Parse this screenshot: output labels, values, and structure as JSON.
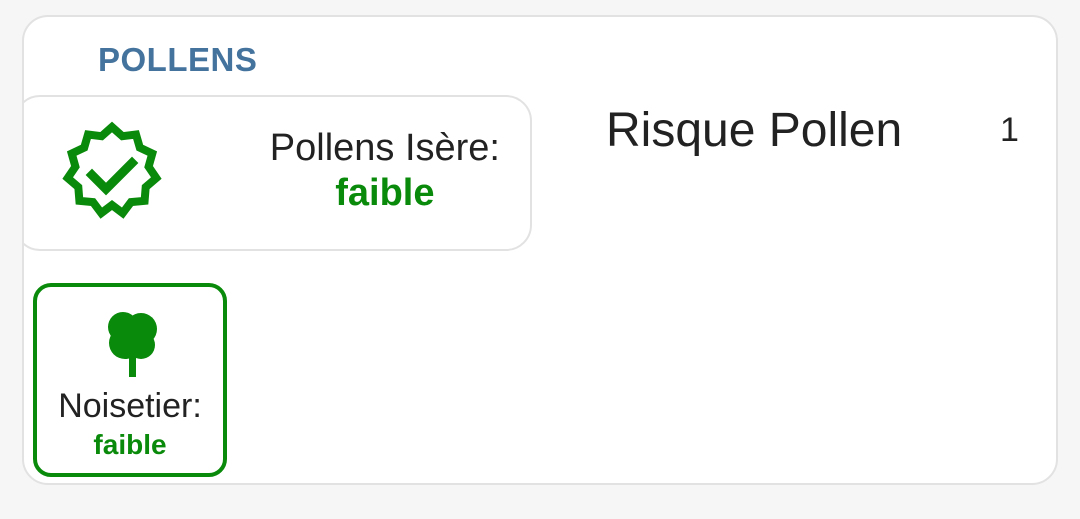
{
  "card": {
    "title": "POLLENS"
  },
  "status": {
    "icon": "check-badge-icon",
    "label": "Pollens Isère:",
    "level": "faible"
  },
  "risk": {
    "title": "Risque Pollen",
    "value": "1"
  },
  "pollens": [
    {
      "icon": "tree-icon",
      "name": "Noisetier:",
      "level": "faible"
    }
  ],
  "colors": {
    "title": "#44739e",
    "accent_green": "#0a8a0a",
    "text": "#222222",
    "border": "#e2e2e2"
  }
}
